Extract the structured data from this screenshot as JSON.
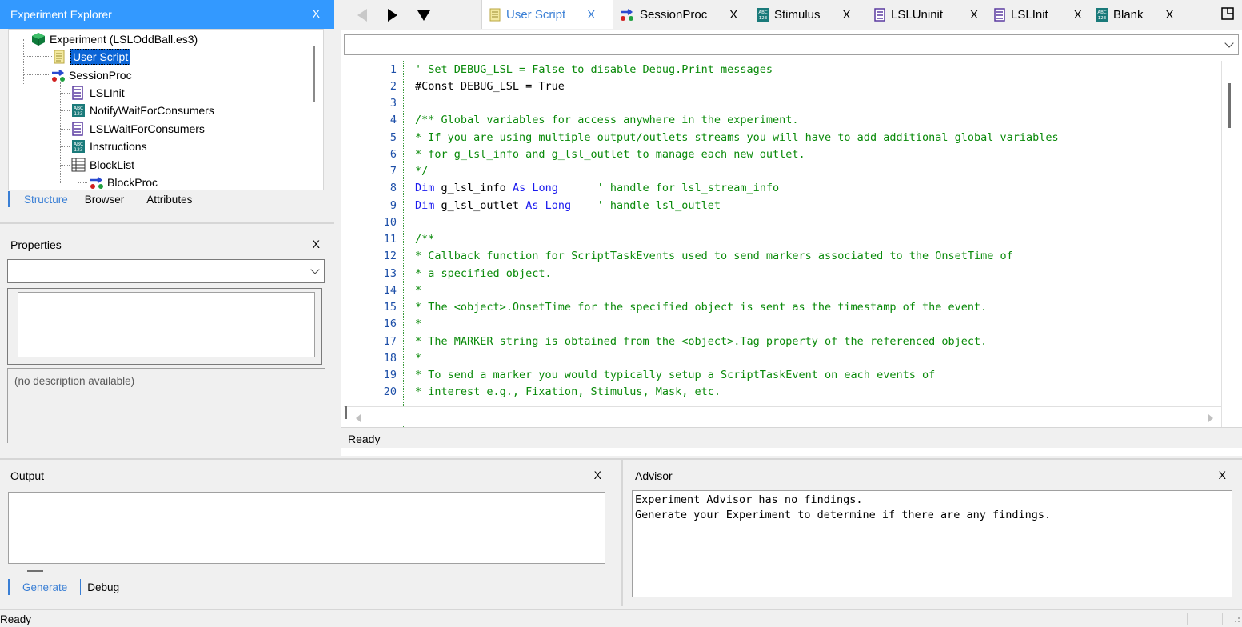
{
  "explorer": {
    "title": "Experiment Explorer",
    "close": "X",
    "tree": [
      {
        "label": "Experiment (LSLOddBall.es3)",
        "icon": "experiment-cube-icon"
      },
      {
        "label": "User Script",
        "icon": "script-icon"
      },
      {
        "label": "SessionProc",
        "icon": "procedure-icon"
      },
      {
        "label": "LSLInit",
        "icon": "inline-script-icon"
      },
      {
        "label": "NotifyWaitForConsumers",
        "icon": "text-display-icon"
      },
      {
        "label": "LSLWaitForConsumers",
        "icon": "inline-script-icon"
      },
      {
        "label": "Instructions",
        "icon": "text-display-icon"
      },
      {
        "label": "BlockList",
        "icon": "list-icon"
      },
      {
        "label": "BlockProc",
        "icon": "procedure-icon"
      }
    ],
    "tabs": [
      "Structure",
      "Browser",
      "Attributes"
    ]
  },
  "properties": {
    "title": "Properties",
    "close": "X",
    "selected_value": "",
    "description": "(no description available)"
  },
  "doc_tabs": [
    {
      "label": "User Script",
      "close": "X",
      "icon": "script-icon",
      "active": true
    },
    {
      "label": "SessionProc",
      "close": "X",
      "icon": "procedure-icon"
    },
    {
      "label": "Stimulus",
      "close": "X",
      "icon": "text-display-icon"
    },
    {
      "label": "LSLUninit",
      "close": "X",
      "icon": "inline-script-icon"
    },
    {
      "label": "LSLInit",
      "close": "X",
      "icon": "inline-script-icon"
    },
    {
      "label": "Blank",
      "close": "X",
      "icon": "text-display-icon"
    }
  ],
  "editor": {
    "combo_value": "",
    "status": "Ready",
    "lines": [
      {
        "n": "1",
        "parts": [
          {
            "t": "' Set DEBUG_LSL = False to disable Debug.Print messages",
            "c": "cm"
          }
        ]
      },
      {
        "n": "2",
        "parts": [
          {
            "t": "#Const DEBUG_LSL = True",
            "c": "tx"
          }
        ]
      },
      {
        "n": "3",
        "parts": []
      },
      {
        "n": "4",
        "parts": [
          {
            "t": "/** Global variables for access anywhere in the experiment.",
            "c": "cm"
          }
        ]
      },
      {
        "n": "5",
        "parts": [
          {
            "t": "* If you are using multiple output/outlets streams you will have to add additional global variables",
            "c": "cm"
          }
        ]
      },
      {
        "n": "6",
        "parts": [
          {
            "t": "* for g_lsl_info and g_lsl_outlet to manage each new outlet.",
            "c": "cm"
          }
        ]
      },
      {
        "n": "7",
        "parts": [
          {
            "t": "*/",
            "c": "cm"
          }
        ]
      },
      {
        "n": "8",
        "parts": [
          {
            "t": "Dim",
            "c": "kw"
          },
          {
            "t": " g_lsl_info ",
            "c": "tx"
          },
          {
            "t": "As Long",
            "c": "kw"
          },
          {
            "t": "      ' handle for lsl_stream_info",
            "c": "cm"
          }
        ]
      },
      {
        "n": "9",
        "parts": [
          {
            "t": "Dim",
            "c": "kw"
          },
          {
            "t": " g_lsl_outlet ",
            "c": "tx"
          },
          {
            "t": "As Long",
            "c": "kw"
          },
          {
            "t": "    ' handle lsl_outlet",
            "c": "cm"
          }
        ]
      },
      {
        "n": "10",
        "parts": []
      },
      {
        "n": "11",
        "parts": [
          {
            "t": "/**",
            "c": "cm"
          }
        ]
      },
      {
        "n": "12",
        "parts": [
          {
            "t": "* Callback function for ScriptTaskEvents used to send markers associated to the OnsetTime of",
            "c": "cm"
          }
        ]
      },
      {
        "n": "13",
        "parts": [
          {
            "t": "* a specified object.",
            "c": "cm"
          }
        ]
      },
      {
        "n": "14",
        "parts": [
          {
            "t": "*",
            "c": "cm"
          }
        ]
      },
      {
        "n": "15",
        "parts": [
          {
            "t": "* The <object>.OnsetTime for the specified object is sent as the timestamp of the event.",
            "c": "cm"
          }
        ]
      },
      {
        "n": "16",
        "parts": [
          {
            "t": "*",
            "c": "cm"
          }
        ]
      },
      {
        "n": "17",
        "parts": [
          {
            "t": "* The MARKER string is obtained from the <object>.Tag property of the referenced object.",
            "c": "cm"
          }
        ]
      },
      {
        "n": "18",
        "parts": [
          {
            "t": "*",
            "c": "cm"
          }
        ]
      },
      {
        "n": "19",
        "parts": [
          {
            "t": "* To send a marker you would typically setup a ScriptTaskEvent on each events of",
            "c": "cm"
          }
        ]
      },
      {
        "n": "20",
        "parts": [
          {
            "t": "* interest e.g., Fixation, Stimulus, Mask, etc.",
            "c": "cm"
          }
        ]
      }
    ]
  },
  "output": {
    "title": "Output",
    "close": "X",
    "tabs": [
      "Generate",
      "Debug"
    ]
  },
  "advisor": {
    "title": "Advisor",
    "close": "X",
    "text": "Experiment Advisor has no findings.\nGenerate your Experiment to determine if there are any findings."
  },
  "statusbar": {
    "text": "Ready"
  },
  "colors": {
    "accent": "#3399ff",
    "comment": "#0a8a0a",
    "keyword": "#1a1aee",
    "line_number": "#1d4fa8"
  }
}
